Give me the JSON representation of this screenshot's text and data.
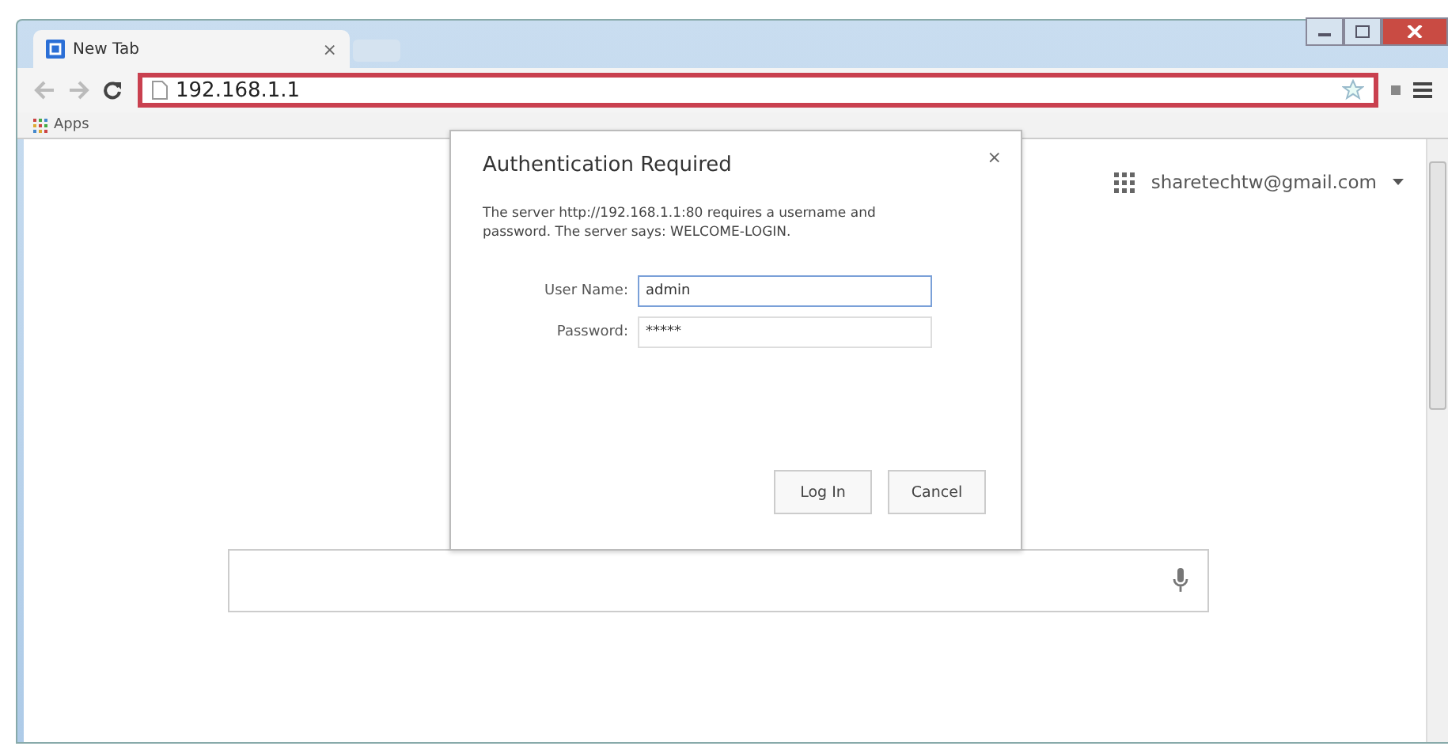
{
  "tabs": [
    {
      "label": "New Tab",
      "close": "×",
      "selected": true
    }
  ],
  "address_bar": {
    "url": "192.168.1.1",
    "highlighted": true
  },
  "bookmarks_bar": {
    "items": [
      "Apps"
    ]
  },
  "account": {
    "email": "sharetechtw@gmail.com"
  },
  "dialog": {
    "title": "Authentication Required",
    "close": "×",
    "message": "The server http://192.168.1.1:80 requires a username and password. The server says: WELCOME-LOGIN.",
    "fields": [
      {
        "label": "User Name:",
        "value": "admin",
        "focused": true
      },
      {
        "label": "Password:",
        "value": "*****",
        "focused": false
      }
    ],
    "buttons": [
      "Log In",
      "Cancel"
    ]
  }
}
